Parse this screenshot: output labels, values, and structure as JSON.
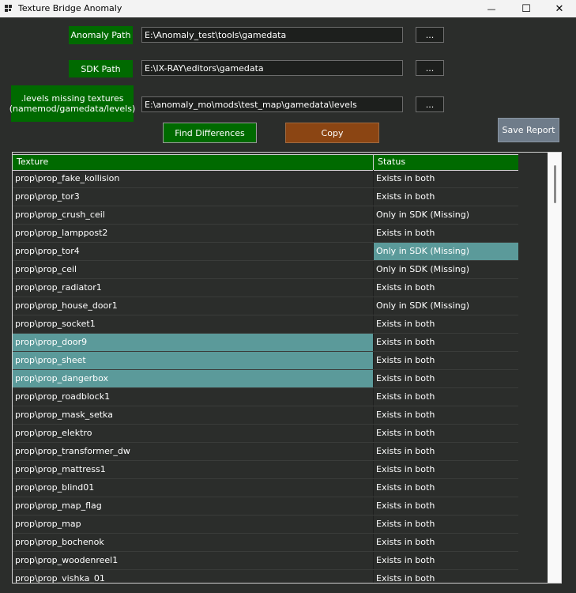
{
  "window": {
    "title": "Texture Bridge Anomaly",
    "minimize_glyph": "—",
    "maximize_glyph": "☐",
    "close_glyph": "✕"
  },
  "form": {
    "anomaly_label": "Anomaly Path",
    "anomaly_value": "E:\\Anomaly_test\\tools\\gamedata",
    "sdk_label": "SDK Path",
    "sdk_value": "E:\\IX-RAY\\editors\\gamedata",
    "levels_label_line1": ".levels missing textures",
    "levels_label_line2": "(namemod/gamedata/levels)",
    "levels_value": "E:\\anomaly_mo\\mods\\test_map\\gamedata\\levels",
    "browse_label": "..."
  },
  "actions": {
    "find_label": "Find Differences",
    "copy_label": "Copy",
    "save_label": "Save Report"
  },
  "table": {
    "col_texture": "Texture",
    "col_status": "Status",
    "rows": [
      {
        "texture": "prop\\prop_fake_kollision",
        "status": "Exists in both"
      },
      {
        "texture": "prop\\prop_tor3",
        "status": "Exists in both"
      },
      {
        "texture": "prop\\prop_crush_ceil",
        "status": "Only in SDK (Missing)"
      },
      {
        "texture": "prop\\prop_lamppost2",
        "status": "Exists in both"
      },
      {
        "texture": "prop\\prop_tor4",
        "status": "Only in SDK (Missing)"
      },
      {
        "texture": "prop\\prop_ceil",
        "status": "Only in SDK (Missing)"
      },
      {
        "texture": "prop\\prop_radiator1",
        "status": "Exists in both"
      },
      {
        "texture": "prop\\prop_house_door1",
        "status": "Only in SDK (Missing)"
      },
      {
        "texture": "prop\\prop_socket1",
        "status": "Exists in both"
      },
      {
        "texture": "prop\\prop_door9",
        "status": "Exists in both"
      },
      {
        "texture": "prop\\prop_sheet",
        "status": "Exists in both"
      },
      {
        "texture": "prop\\prop_dangerbox",
        "status": "Exists in both"
      },
      {
        "texture": "prop\\prop_roadblock1",
        "status": "Exists in both"
      },
      {
        "texture": "prop\\prop_mask_setka",
        "status": "Exists in both"
      },
      {
        "texture": "prop\\prop_elektro",
        "status": "Exists in both"
      },
      {
        "texture": "prop\\prop_transformer_dw",
        "status": "Exists in both"
      },
      {
        "texture": "prop\\prop_mattress1",
        "status": "Exists in both"
      },
      {
        "texture": "prop\\prop_blind01",
        "status": "Exists in both"
      },
      {
        "texture": "prop\\prop_map_flag",
        "status": "Exists in both"
      },
      {
        "texture": "prop\\prop_map",
        "status": "Exists in both"
      },
      {
        "texture": "prop\\prop_bochenok",
        "status": "Exists in both"
      },
      {
        "texture": "prop\\prop_woodenreel1",
        "status": "Exists in both"
      },
      {
        "texture": "prop\\prop_vishka_01",
        "status": "Exists in both"
      }
    ]
  },
  "colors": {
    "label_green": "#006a00",
    "copy_brown": "#8b4513",
    "save_gray": "#6f7c8a",
    "selection": "#5b9a9a"
  }
}
